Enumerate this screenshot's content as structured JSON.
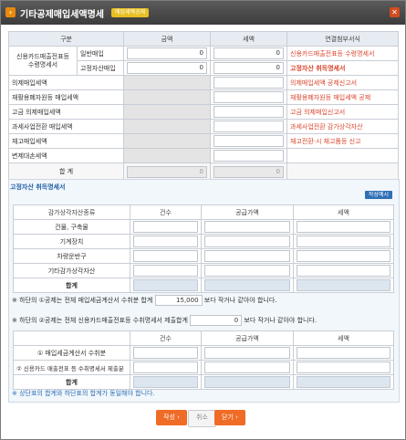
{
  "window": {
    "title": "기타공제매입세액명세",
    "badge": "매입세액공제",
    "close_glyph": "✕",
    "title_icon_glyph": "›"
  },
  "table1": {
    "headers": {
      "division": "구분",
      "amount": "금액",
      "tax": "세액",
      "attachment": "연결첨부서식"
    },
    "group_label": "신용카드매출전표등\n수령명세서",
    "group_line1": "신용카드매출전표등",
    "group_line2": "수령명세서",
    "rows": [
      {
        "label": "일반매입",
        "amount": "0",
        "tax": "0",
        "link": "신용카드매출전표등 수령명세서",
        "link_bold": false
      },
      {
        "label": "고정자산매입",
        "amount": "0",
        "tax": "0",
        "link": "고정자산 취득명세서",
        "link_bold": true
      },
      {
        "label": "의제매입세액",
        "amount": "",
        "tax": "",
        "link": "의제매입세액 공제신고서",
        "link_bold": false
      },
      {
        "label": "재활용폐자원등 매입세액",
        "amount": "",
        "tax": "",
        "link": "재활용폐자원등 매입세액 공제",
        "link_bold": false
      },
      {
        "label": "고금 의제매입세액",
        "amount": "",
        "tax": "",
        "link": "고금 의제매입신고서",
        "link_bold": false
      },
      {
        "label": "과세사업전환 매입세액",
        "amount": "",
        "tax": "",
        "link": "과세사업전환 감가상각자산",
        "link_bold": false
      },
      {
        "label": "재고매입세액",
        "amount": "",
        "tax": "",
        "link": "재고전환·시 재고품등 신고",
        "link_bold": false
      },
      {
        "label": "변제대손세액",
        "amount": "",
        "tax": "",
        "link": "",
        "link_bold": false
      }
    ],
    "total_label": "합 계",
    "total_amount": "0",
    "total_tax": "0"
  },
  "section2": {
    "title": "고정자산 취득명세서",
    "button": "작성예시",
    "headers": {
      "type": "감가상각자산종류",
      "count": "건수",
      "supply": "공급가액",
      "tax": "세액"
    },
    "rows": [
      "건물, 구축물",
      "기계장치",
      "차량운반구",
      "기타감가상각자산"
    ],
    "total_label": "합계"
  },
  "notes": {
    "note1_prefix": "※ 하단의 ①공제는 전체 매입세금계산서 수취분 합계",
    "note1_value": "15,000",
    "note1_suffix": "보다 작거나 같아야 합니다.",
    "note2_prefix": "※ 하단의 ②공제는 전체 신용카드매출전표등 수취명세서 제출합계",
    "note2_value": "0",
    "note2_suffix": "보다 작거나 같아야 합니다.",
    "note3": "※ 상단표의 합계와 하단표의 합계가 동일해야 합니다."
  },
  "table3": {
    "headers": {
      "count": "건수",
      "supply": "공급가액",
      "tax": "세액"
    },
    "rows": [
      "① 매입세금계산서 수취분",
      "② 신용카드 매출전표 등 수취명세서 제출분"
    ],
    "total_label": "합계"
  },
  "footer": {
    "save": "작성",
    "cancel": "취소",
    "close": "닫기",
    "arrow": "›"
  }
}
